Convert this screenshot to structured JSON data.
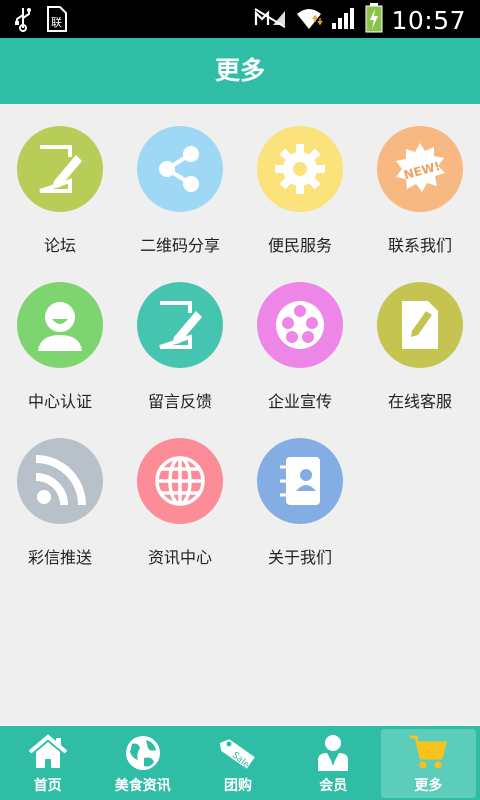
{
  "status_bar": {
    "time": "10:57"
  },
  "header": {
    "title": "更多"
  },
  "grid": [
    {
      "label": "论坛",
      "icon": "edit-icon",
      "color": "#b7cd57"
    },
    {
      "label": "二维码分享",
      "icon": "share-icon",
      "color": "#9fd8f4"
    },
    {
      "label": "便民服务",
      "icon": "gear-icon",
      "color": "#fbe27b"
    },
    {
      "label": "联系我们",
      "icon": "new-badge-icon",
      "color": "#f8b882"
    },
    {
      "label": "中心认证",
      "icon": "user-icon",
      "color": "#7ed56f"
    },
    {
      "label": "留言反馈",
      "icon": "edit-icon",
      "color": "#45c4b0"
    },
    {
      "label": "企业宣传",
      "icon": "film-reel-icon",
      "color": "#ee86e8"
    },
    {
      "label": "在线客服",
      "icon": "document-edit-icon",
      "color": "#c6c450"
    },
    {
      "label": "彩信推送",
      "icon": "rss-icon",
      "color": "#b8c0c9"
    },
    {
      "label": "资讯中心",
      "icon": "globe-icon",
      "color": "#fb8c98"
    },
    {
      "label": "关于我们",
      "icon": "contacts-book-icon",
      "color": "#84aee3"
    }
  ],
  "bottom_nav": [
    {
      "label": "首页",
      "icon": "home-icon"
    },
    {
      "label": "美食资讯",
      "icon": "globe-icon"
    },
    {
      "label": "团购",
      "icon": "sale-tag-icon"
    },
    {
      "label": "会员",
      "icon": "member-icon"
    },
    {
      "label": "更多",
      "icon": "cart-icon",
      "active": true
    }
  ]
}
